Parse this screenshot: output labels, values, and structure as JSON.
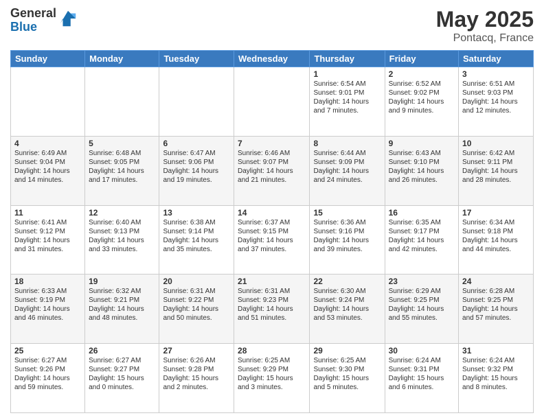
{
  "logo": {
    "general": "General",
    "blue": "Blue"
  },
  "title": "May 2025",
  "location": "Pontacq, France",
  "days_header": [
    "Sunday",
    "Monday",
    "Tuesday",
    "Wednesday",
    "Thursday",
    "Friday",
    "Saturday"
  ],
  "weeks": [
    [
      {
        "day": "",
        "info": ""
      },
      {
        "day": "",
        "info": ""
      },
      {
        "day": "",
        "info": ""
      },
      {
        "day": "",
        "info": ""
      },
      {
        "day": "1",
        "info": "Sunrise: 6:54 AM\nSunset: 9:01 PM\nDaylight: 14 hours\nand 7 minutes."
      },
      {
        "day": "2",
        "info": "Sunrise: 6:52 AM\nSunset: 9:02 PM\nDaylight: 14 hours\nand 9 minutes."
      },
      {
        "day": "3",
        "info": "Sunrise: 6:51 AM\nSunset: 9:03 PM\nDaylight: 14 hours\nand 12 minutes."
      }
    ],
    [
      {
        "day": "4",
        "info": "Sunrise: 6:49 AM\nSunset: 9:04 PM\nDaylight: 14 hours\nand 14 minutes."
      },
      {
        "day": "5",
        "info": "Sunrise: 6:48 AM\nSunset: 9:05 PM\nDaylight: 14 hours\nand 17 minutes."
      },
      {
        "day": "6",
        "info": "Sunrise: 6:47 AM\nSunset: 9:06 PM\nDaylight: 14 hours\nand 19 minutes."
      },
      {
        "day": "7",
        "info": "Sunrise: 6:46 AM\nSunset: 9:07 PM\nDaylight: 14 hours\nand 21 minutes."
      },
      {
        "day": "8",
        "info": "Sunrise: 6:44 AM\nSunset: 9:09 PM\nDaylight: 14 hours\nand 24 minutes."
      },
      {
        "day": "9",
        "info": "Sunrise: 6:43 AM\nSunset: 9:10 PM\nDaylight: 14 hours\nand 26 minutes."
      },
      {
        "day": "10",
        "info": "Sunrise: 6:42 AM\nSunset: 9:11 PM\nDaylight: 14 hours\nand 28 minutes."
      }
    ],
    [
      {
        "day": "11",
        "info": "Sunrise: 6:41 AM\nSunset: 9:12 PM\nDaylight: 14 hours\nand 31 minutes."
      },
      {
        "day": "12",
        "info": "Sunrise: 6:40 AM\nSunset: 9:13 PM\nDaylight: 14 hours\nand 33 minutes."
      },
      {
        "day": "13",
        "info": "Sunrise: 6:38 AM\nSunset: 9:14 PM\nDaylight: 14 hours\nand 35 minutes."
      },
      {
        "day": "14",
        "info": "Sunrise: 6:37 AM\nSunset: 9:15 PM\nDaylight: 14 hours\nand 37 minutes."
      },
      {
        "day": "15",
        "info": "Sunrise: 6:36 AM\nSunset: 9:16 PM\nDaylight: 14 hours\nand 39 minutes."
      },
      {
        "day": "16",
        "info": "Sunrise: 6:35 AM\nSunset: 9:17 PM\nDaylight: 14 hours\nand 42 minutes."
      },
      {
        "day": "17",
        "info": "Sunrise: 6:34 AM\nSunset: 9:18 PM\nDaylight: 14 hours\nand 44 minutes."
      }
    ],
    [
      {
        "day": "18",
        "info": "Sunrise: 6:33 AM\nSunset: 9:19 PM\nDaylight: 14 hours\nand 46 minutes."
      },
      {
        "day": "19",
        "info": "Sunrise: 6:32 AM\nSunset: 9:21 PM\nDaylight: 14 hours\nand 48 minutes."
      },
      {
        "day": "20",
        "info": "Sunrise: 6:31 AM\nSunset: 9:22 PM\nDaylight: 14 hours\nand 50 minutes."
      },
      {
        "day": "21",
        "info": "Sunrise: 6:31 AM\nSunset: 9:23 PM\nDaylight: 14 hours\nand 51 minutes."
      },
      {
        "day": "22",
        "info": "Sunrise: 6:30 AM\nSunset: 9:24 PM\nDaylight: 14 hours\nand 53 minutes."
      },
      {
        "day": "23",
        "info": "Sunrise: 6:29 AM\nSunset: 9:25 PM\nDaylight: 14 hours\nand 55 minutes."
      },
      {
        "day": "24",
        "info": "Sunrise: 6:28 AM\nSunset: 9:25 PM\nDaylight: 14 hours\nand 57 minutes."
      }
    ],
    [
      {
        "day": "25",
        "info": "Sunrise: 6:27 AM\nSunset: 9:26 PM\nDaylight: 14 hours\nand 59 minutes."
      },
      {
        "day": "26",
        "info": "Sunrise: 6:27 AM\nSunset: 9:27 PM\nDaylight: 15 hours\nand 0 minutes."
      },
      {
        "day": "27",
        "info": "Sunrise: 6:26 AM\nSunset: 9:28 PM\nDaylight: 15 hours\nand 2 minutes."
      },
      {
        "day": "28",
        "info": "Sunrise: 6:25 AM\nSunset: 9:29 PM\nDaylight: 15 hours\nand 3 minutes."
      },
      {
        "day": "29",
        "info": "Sunrise: 6:25 AM\nSunset: 9:30 PM\nDaylight: 15 hours\nand 5 minutes."
      },
      {
        "day": "30",
        "info": "Sunrise: 6:24 AM\nSunset: 9:31 PM\nDaylight: 15 hours\nand 6 minutes."
      },
      {
        "day": "31",
        "info": "Sunrise: 6:24 AM\nSunset: 9:32 PM\nDaylight: 15 hours\nand 8 minutes."
      }
    ]
  ]
}
